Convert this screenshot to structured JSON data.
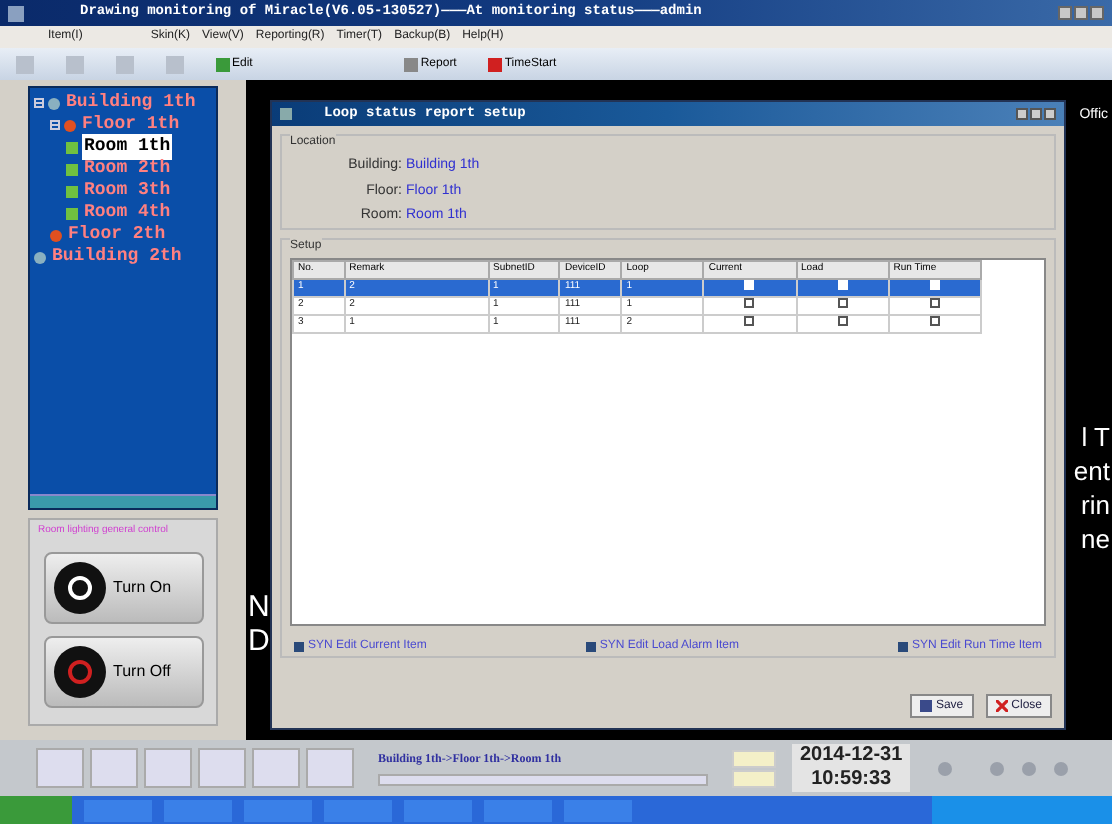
{
  "window": {
    "title": "Drawing monitoring of Miracle(V6.05-130527)———At monitoring status———admin"
  },
  "menu": [
    "Item(I)",
    "Skin(K)",
    "View(V)",
    "Reporting(R)",
    "Timer(T)",
    "Backup(B)",
    "Help(H)"
  ],
  "toolbar": [
    {
      "kind": "edit",
      "label": "Edit"
    },
    {
      "kind": "report",
      "label": "Report"
    },
    {
      "kind": "timer",
      "label": "TimeStart"
    }
  ],
  "tree": [
    {
      "label": "Building 1th",
      "kind": "building",
      "selected": false,
      "expanded": true,
      "children": [
        {
          "label": "Floor 1th",
          "kind": "floor",
          "selected": false,
          "expanded": true,
          "children": [
            {
              "label": "Room 1th",
              "kind": "room",
              "selected": true
            },
            {
              "label": "Room 2th",
              "kind": "room",
              "selected": false
            },
            {
              "label": "Room 3th",
              "kind": "room",
              "selected": false
            },
            {
              "label": "Room 4th",
              "kind": "room",
              "selected": false
            }
          ]
        },
        {
          "label": "Floor 2th",
          "kind": "floor",
          "selected": false,
          "expanded": false
        }
      ]
    },
    {
      "label": "Building 2th",
      "kind": "building",
      "selected": false,
      "expanded": false
    }
  ],
  "control_panel": {
    "title": "Room lighting general control",
    "buttons": [
      {
        "kind": "on",
        "label": "Turn On"
      },
      {
        "kind": "off",
        "label": "Turn Off"
      }
    ]
  },
  "canvas_fragments": {
    "left": [
      "N",
      "D"
    ],
    "right": [
      "l T",
      "ent",
      "rin",
      "ne"
    ],
    "top": "Offic"
  },
  "dialog": {
    "title": "Loop status report setup",
    "location": {
      "title": "Location",
      "fields": [
        {
          "label": "Building:",
          "value": "Building 1th"
        },
        {
          "label": "Floor:",
          "value": "Floor 1th"
        },
        {
          "label": "Room:",
          "value": "Room 1th"
        }
      ]
    },
    "setup": {
      "title": "Setup",
      "columns": [
        "No.",
        "Remark",
        "SubnetID",
        "DeviceID",
        "Loop",
        "Current",
        "Load",
        "Run Time"
      ],
      "rows": [
        {
          "cells": [
            "1",
            "2",
            "1",
            "111",
            "1"
          ],
          "current": false,
          "load": false,
          "run_time": false,
          "selected": true
        },
        {
          "cells": [
            "2",
            "2",
            "1",
            "111",
            "1"
          ],
          "current": false,
          "load": false,
          "run_time": false,
          "selected": false
        },
        {
          "cells": [
            "3",
            "1",
            "1",
            "111",
            "2"
          ],
          "current": false,
          "load": false,
          "run_time": false,
          "selected": false
        }
      ]
    },
    "sync_links": [
      "SYN Edit Current Item",
      "SYN Edit Load Alarm Item",
      "SYN Edit Run Time Item"
    ],
    "buttons": [
      {
        "kind": "save",
        "label": "Save"
      },
      {
        "kind": "close",
        "label": "Close"
      }
    ]
  },
  "status": {
    "path": "Building 1th->Floor 1th->Room 1th",
    "date": "2014-12-31",
    "time": "10:59:33"
  }
}
